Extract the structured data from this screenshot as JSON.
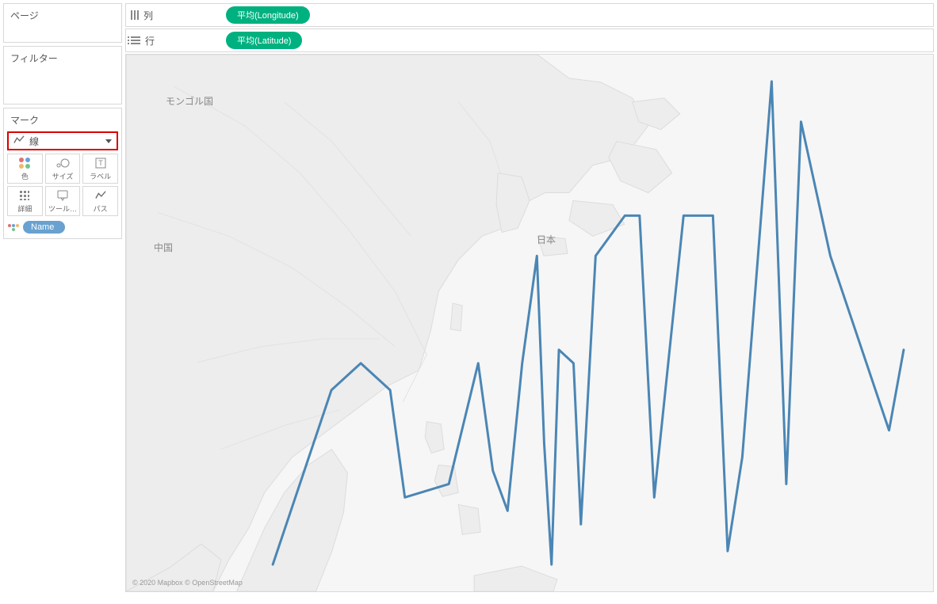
{
  "left": {
    "pages_title": "ページ",
    "filters_title": "フィルター",
    "marks_title": "マーク",
    "mark_type_label": "線",
    "cells": {
      "color": "色",
      "size": "サイズ",
      "label": "ラベル",
      "detail": "詳細",
      "tooltip": "ツール…",
      "path": "パス"
    },
    "name_pill": "Name"
  },
  "shelves": {
    "columns_label": "列",
    "rows_label": "行",
    "columns_pill": "平均(Longitude)",
    "rows_pill": "平均(Latitude)"
  },
  "map": {
    "labels": {
      "mongolia": "モンゴル国",
      "china": "中国",
      "japan": "日本"
    },
    "attribution": "© 2020 Mapbox © OpenStreetMap"
  },
  "colors": {
    "pill_green": "#00B180",
    "pill_blue": "#69a1d0",
    "line_stroke": "#4b86b4",
    "highlight_border": "#d90000"
  },
  "chart_data": {
    "type": "line",
    "note": "Line drawn over map background connecting points by Name; axes are geographic Longitude (x) and Latitude (y). Values read approximately from map context.",
    "xlabel": "平均(Longitude)",
    "ylabel": "平均(Latitude)",
    "xlim": [
      95,
      150
    ],
    "ylim": [
      5,
      45
    ],
    "series": [
      {
        "name": "Name",
        "points": [
          {
            "lon": 105,
            "lat": 7
          },
          {
            "lon": 109,
            "lat": 20
          },
          {
            "lon": 111,
            "lat": 22
          },
          {
            "lon": 113,
            "lat": 20
          },
          {
            "lon": 114,
            "lat": 12
          },
          {
            "lon": 117,
            "lat": 13
          },
          {
            "lon": 119,
            "lat": 22
          },
          {
            "lon": 120,
            "lat": 14
          },
          {
            "lon": 121,
            "lat": 11
          },
          {
            "lon": 122,
            "lat": 22
          },
          {
            "lon": 123,
            "lat": 30
          },
          {
            "lon": 123.5,
            "lat": 16
          },
          {
            "lon": 124,
            "lat": 7
          },
          {
            "lon": 124.5,
            "lat": 23
          },
          {
            "lon": 125.5,
            "lat": 22
          },
          {
            "lon": 126,
            "lat": 10
          },
          {
            "lon": 127,
            "lat": 30
          },
          {
            "lon": 129,
            "lat": 33
          },
          {
            "lon": 130,
            "lat": 33
          },
          {
            "lon": 131,
            "lat": 12
          },
          {
            "lon": 133,
            "lat": 33
          },
          {
            "lon": 135,
            "lat": 33
          },
          {
            "lon": 136,
            "lat": 8
          },
          {
            "lon": 137,
            "lat": 15
          },
          {
            "lon": 139,
            "lat": 43
          },
          {
            "lon": 140,
            "lat": 13
          },
          {
            "lon": 141,
            "lat": 40
          },
          {
            "lon": 143,
            "lat": 30
          },
          {
            "lon": 147,
            "lat": 17
          },
          {
            "lon": 148,
            "lat": 23
          }
        ]
      }
    ]
  }
}
